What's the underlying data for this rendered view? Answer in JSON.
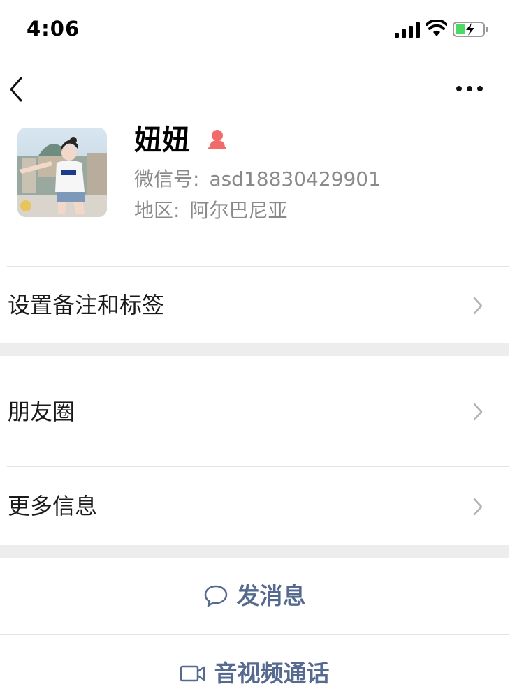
{
  "status_bar": {
    "time": "4:06"
  },
  "nav": {
    "back_icon": "chevron-left-icon",
    "more_icon": "more-dots-icon"
  },
  "profile": {
    "name": "妞妞",
    "gender_icon": "female-icon",
    "gender_color": "#f26b6b",
    "wechat_id_label": "微信号:",
    "wechat_id": "asd18830429901",
    "region_label": "地区:",
    "region": "阿尔巴尼亚"
  },
  "rows": [
    {
      "label": "设置备注和标签"
    },
    {
      "label": "朋友圈"
    },
    {
      "label": "更多信息"
    }
  ],
  "actions": {
    "message_label": "发消息",
    "message_icon": "chat-bubble-icon",
    "call_label": "音视频通话",
    "call_icon": "video-camera-icon",
    "action_color": "#566a8f"
  }
}
